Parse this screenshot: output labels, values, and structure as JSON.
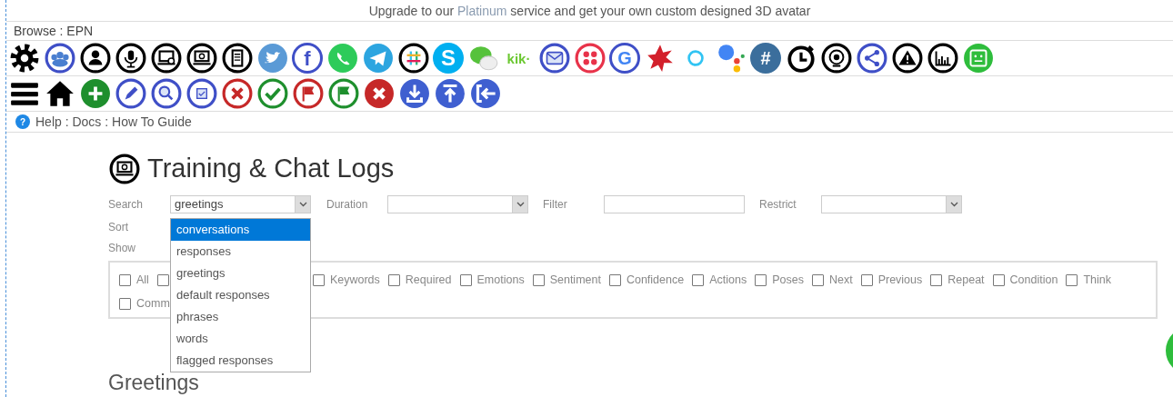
{
  "banner": "Upgrade to our **Platinum** service and get your own custom designed 3D avatar",
  "browse": "Browse : EPN",
  "toolbar_top": [
    {
      "kind": "icon"
    },
    {
      "kind": "icon"
    },
    {
      "kind": "icon"
    },
    {
      "kind": "icon"
    },
    {
      "kind": "icon"
    },
    {
      "kind": "icon"
    },
    {
      "kind": "icon"
    },
    {
      "kind": "icon"
    },
    {
      "kind": "letter",
      "glyph": "f"
    },
    {
      "kind": "icon"
    },
    {
      "kind": "icon"
    },
    {
      "kind": "icon"
    },
    {
      "kind": "letter",
      "glyph": "S"
    },
    {
      "kind": "icon"
    },
    {
      "kind": "letter",
      "glyph": "kik·"
    },
    {
      "kind": "icon"
    },
    {
      "kind": "icon"
    },
    {
      "kind": "letter",
      "glyph": "G"
    },
    {
      "kind": "icon"
    },
    {
      "kind": "icon"
    },
    {
      "kind": "icon"
    },
    {
      "kind": "letter",
      "glyph": "#"
    },
    {
      "kind": "icon"
    },
    {
      "kind": "icon"
    },
    {
      "kind": "icon"
    },
    {
      "kind": "icon"
    },
    {
      "kind": "icon"
    },
    {
      "kind": "icon"
    }
  ],
  "help": {
    "icon": "?",
    "text": "Help : Docs : How To Guide"
  },
  "title": "Training & Chat Logs",
  "form": {
    "search_label": "Search",
    "search_value": "greetings",
    "duration_label": "Duration",
    "filter_label": "Filter",
    "restrict_label": "Restrict",
    "sort_label": "Sort",
    "show_label": "Show"
  },
  "search_options": [
    {
      "label": "conversations",
      "selected": true
    },
    {
      "label": "responses",
      "selected": false
    },
    {
      "label": "greetings",
      "selected": false
    },
    {
      "label": "default responses",
      "selected": false
    },
    {
      "label": "phrases",
      "selected": false
    },
    {
      "label": "words",
      "selected": false
    },
    {
      "label": "flagged responses",
      "selected": false
    }
  ],
  "show_rows": [
    [
      {
        "label": "All",
        "checked": false
      },
      {
        "checked": false
      },
      {
        "label": "Keywords",
        "checked": false
      },
      {
        "label": "Required",
        "checked": false
      },
      {
        "label": "Emotions",
        "checked": false
      },
      {
        "label": "Sentiment",
        "checked": false
      },
      {
        "label": "Confidence",
        "checked": false
      },
      {
        "label": "Actions",
        "checked": false
      },
      {
        "label": "Poses",
        "checked": false
      },
      {
        "label": "Next",
        "checked": false
      },
      {
        "label": "Previous",
        "checked": false
      },
      {
        "label": "Repeat",
        "checked": false
      },
      {
        "label": "Condition",
        "checked": false
      },
      {
        "label": "Think",
        "checked": false
      }
    ],
    [
      {
        "label": "Comm",
        "checked": false
      }
    ]
  ],
  "section_title": "Greetings"
}
